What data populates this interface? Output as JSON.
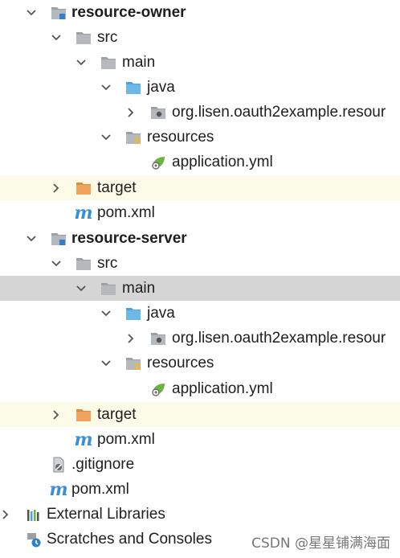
{
  "tree": {
    "module1": {
      "name": "resource-owner",
      "src": "src",
      "main": "main",
      "java": "java",
      "package": "org.lisen.oauth2example.resour",
      "resources": "resources",
      "app_yml": "application.yml",
      "target": "target",
      "pom": "pom.xml"
    },
    "module2": {
      "name": "resource-server",
      "src": "src",
      "main": "main",
      "java": "java",
      "package": "org.lisen.oauth2example.resour",
      "resources": "resources",
      "app_yml": "application.yml",
      "target": "target",
      "pom": "pom.xml"
    },
    "gitignore": ".gitignore",
    "root_pom": "pom.xml",
    "external_libraries": "External Libraries",
    "scratches": "Scratches and Consoles"
  },
  "watermark": "CSDN @星星铺满海面",
  "colors": {
    "target_bg": "#fcfbe7",
    "selected_bg": "#d5d5d5",
    "java_folder": "#6cb8e6",
    "target_folder": "#f0a35e",
    "spring_leaf": "#6db33f"
  }
}
